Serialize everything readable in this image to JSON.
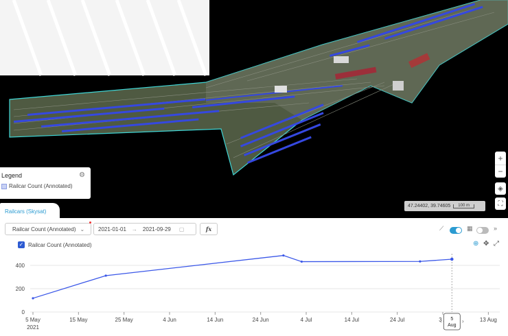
{
  "map": {
    "legend": {
      "title": "Legend",
      "item": "Railcar Count (Annotated)",
      "swatch_color": "#c9d2f4"
    },
    "zoom_in": "+",
    "zoom_out": "−",
    "coordinates": "47.24402, 39.74605",
    "scale_label": "100 m",
    "aoi_outline_color": "#3fd6d6",
    "railcar_color": "#3548e0"
  },
  "tab": {
    "label": "Railcars (Skysat)"
  },
  "toolbar": {
    "metric_select": "Railcar Count (Annotated)",
    "date_start": "2021-01-01",
    "date_arrow": "→",
    "date_end": "2021-09-29",
    "fx_label": "fx"
  },
  "series_toggle": {
    "label": "Railcar Count (Annotated)"
  },
  "tooltip": {
    "day": "5",
    "month": "Aug"
  },
  "chart_data": {
    "type": "line",
    "series": [
      {
        "name": "Railcar Count (Annotated)",
        "color": "#3a57e8",
        "points": [
          [
            "2021-05-05",
            118
          ],
          [
            "2021-05-21",
            312
          ],
          [
            "2021-06-29",
            485
          ],
          [
            "2021-07-03",
            432
          ],
          [
            "2021-07-29",
            434
          ],
          [
            "2021-08-05",
            453
          ]
        ]
      }
    ],
    "xlim": [
      "2021-05-05",
      "2021-08-14"
    ],
    "ylim": [
      0,
      500
    ],
    "yticks": [
      0,
      200,
      400
    ],
    "xticks": [
      {
        "date": "2021-05-05",
        "label": "5 May",
        "sub": "2021"
      },
      {
        "date": "2021-05-15",
        "label": "15 May"
      },
      {
        "date": "2021-05-25",
        "label": "25 May"
      },
      {
        "date": "2021-06-04",
        "label": "4 Jun"
      },
      {
        "date": "2021-06-14",
        "label": "14 Jun"
      },
      {
        "date": "2021-06-24",
        "label": "24 Jun"
      },
      {
        "date": "2021-07-04",
        "label": "4 Jul"
      },
      {
        "date": "2021-07-14",
        "label": "14 Jul"
      },
      {
        "date": "2021-07-24",
        "label": "24 Jul"
      },
      {
        "date": "2021-08-03",
        "label": "3 A"
      },
      {
        "date": "2021-08-13",
        "label": "13 Aug"
      }
    ],
    "grid": true,
    "hover_date": "2021-08-05"
  }
}
